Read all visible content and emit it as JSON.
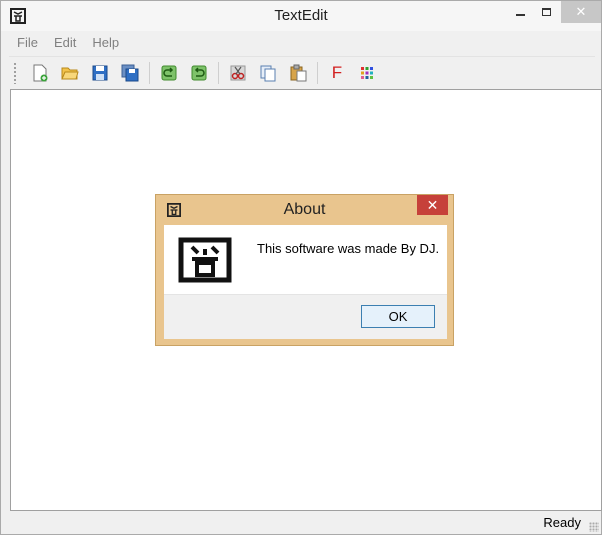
{
  "window": {
    "title": "TextEdit",
    "minimize_icon": "minimize-icon",
    "maximize_icon": "maximize-icon",
    "close_icon": "close-icon",
    "close_glyph": "✕"
  },
  "menu": {
    "items": [
      {
        "label": "File"
      },
      {
        "label": "Edit"
      },
      {
        "label": "Help"
      }
    ]
  },
  "toolbar": {
    "buttons": [
      {
        "icon": "new-file-icon"
      },
      {
        "icon": "open-folder-icon"
      },
      {
        "icon": "save-icon"
      },
      {
        "icon": "save-as-icon"
      },
      {
        "icon": "undo-icon"
      },
      {
        "icon": "redo-icon"
      },
      {
        "icon": "cut-icon"
      },
      {
        "icon": "copy-icon"
      },
      {
        "icon": "paste-icon"
      },
      {
        "icon": "font-icon",
        "glyph": "F"
      },
      {
        "icon": "color-icon"
      }
    ]
  },
  "status": {
    "text": "Ready"
  },
  "about_dialog": {
    "title": "About",
    "message": "This software was made By DJ.",
    "ok_label": "OK",
    "close_glyph": "✕"
  },
  "colors": {
    "dialog_frame": "#e9c58e",
    "dialog_close": "#c6413a",
    "ok_border": "#3c7fb1",
    "font_icon": "#d22020"
  }
}
